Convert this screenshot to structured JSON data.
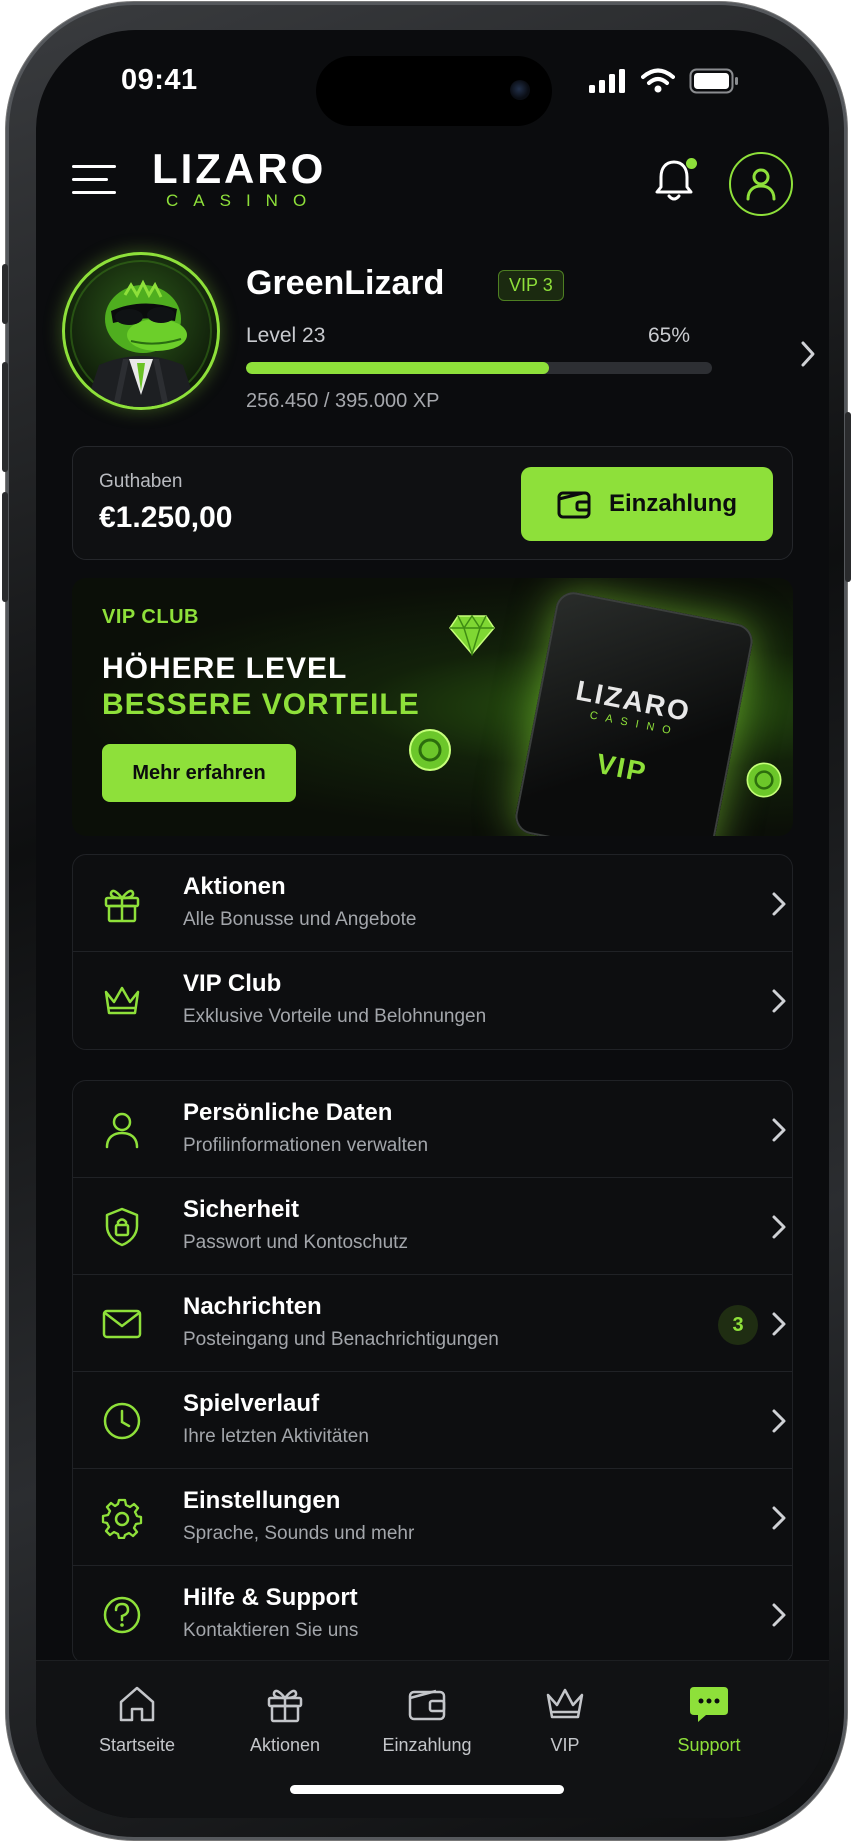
{
  "status_bar": {
    "time": "09:41"
  },
  "header": {
    "logo_main": "LIZARO",
    "logo_sub": "CASINO",
    "notification_dot": true
  },
  "profile": {
    "username": "GreenLizard",
    "vip_badge": "VIP 3",
    "level_label": "Level 23",
    "level_progress_pct": "65%",
    "level_progress": 0.65,
    "xp_text": "256.450 / 395.000 XP"
  },
  "balance": {
    "label": "Guthaben",
    "value": "€1.250,00",
    "deposit_label": "Einzahlung"
  },
  "vip_banner": {
    "kicker": "VIP CLUB",
    "headline_1": "HÖHERE LEVEL",
    "headline_2": "BESSERE VORTEILE",
    "button_label": "Mehr erfahren",
    "card_logo": "LIZARO",
    "card_sub": "CASINO",
    "card_vip": "VIP"
  },
  "menu_group_1": [
    {
      "icon": "gift-icon",
      "title": "Aktionen",
      "subtitle": "Alle Bonusse und Angebote"
    },
    {
      "icon": "crown-icon",
      "title": "VIP Club",
      "subtitle": "Exklusive Vorteile und Belohnungen"
    }
  ],
  "menu_group_2": [
    {
      "icon": "user-icon",
      "title": "Persönliche Daten",
      "subtitle": "Profilinformationen verwalten"
    },
    {
      "icon": "shield-lock-icon",
      "title": "Sicherheit",
      "subtitle": "Passwort und Kontoschutz"
    },
    {
      "icon": "mail-icon",
      "title": "Nachrichten",
      "subtitle": "Posteingang und Benachrichtigungen",
      "badge": "3"
    },
    {
      "icon": "clock-icon",
      "title": "Spielverlauf",
      "subtitle": "Ihre letzten Aktivitäten"
    },
    {
      "icon": "gear-icon",
      "title": "Einstellungen",
      "subtitle": "Sprache, Sounds und mehr"
    },
    {
      "icon": "help-icon",
      "title": "Hilfe & Support",
      "subtitle": "Kontaktieren Sie uns"
    }
  ],
  "tabbar": [
    {
      "icon": "home-icon",
      "label": "Startseite"
    },
    {
      "icon": "gift-icon",
      "label": "Aktionen"
    },
    {
      "icon": "wallet-icon",
      "label": "Einzahlung"
    },
    {
      "icon": "crown-icon",
      "label": "VIP"
    },
    {
      "icon": "chat-icon",
      "label": "Support",
      "active": true
    }
  ],
  "colors": {
    "accent": "#8ee03a",
    "background": "#0b0c0e",
    "card": "#0d0e10",
    "muted_text": "#a3a6ab"
  }
}
